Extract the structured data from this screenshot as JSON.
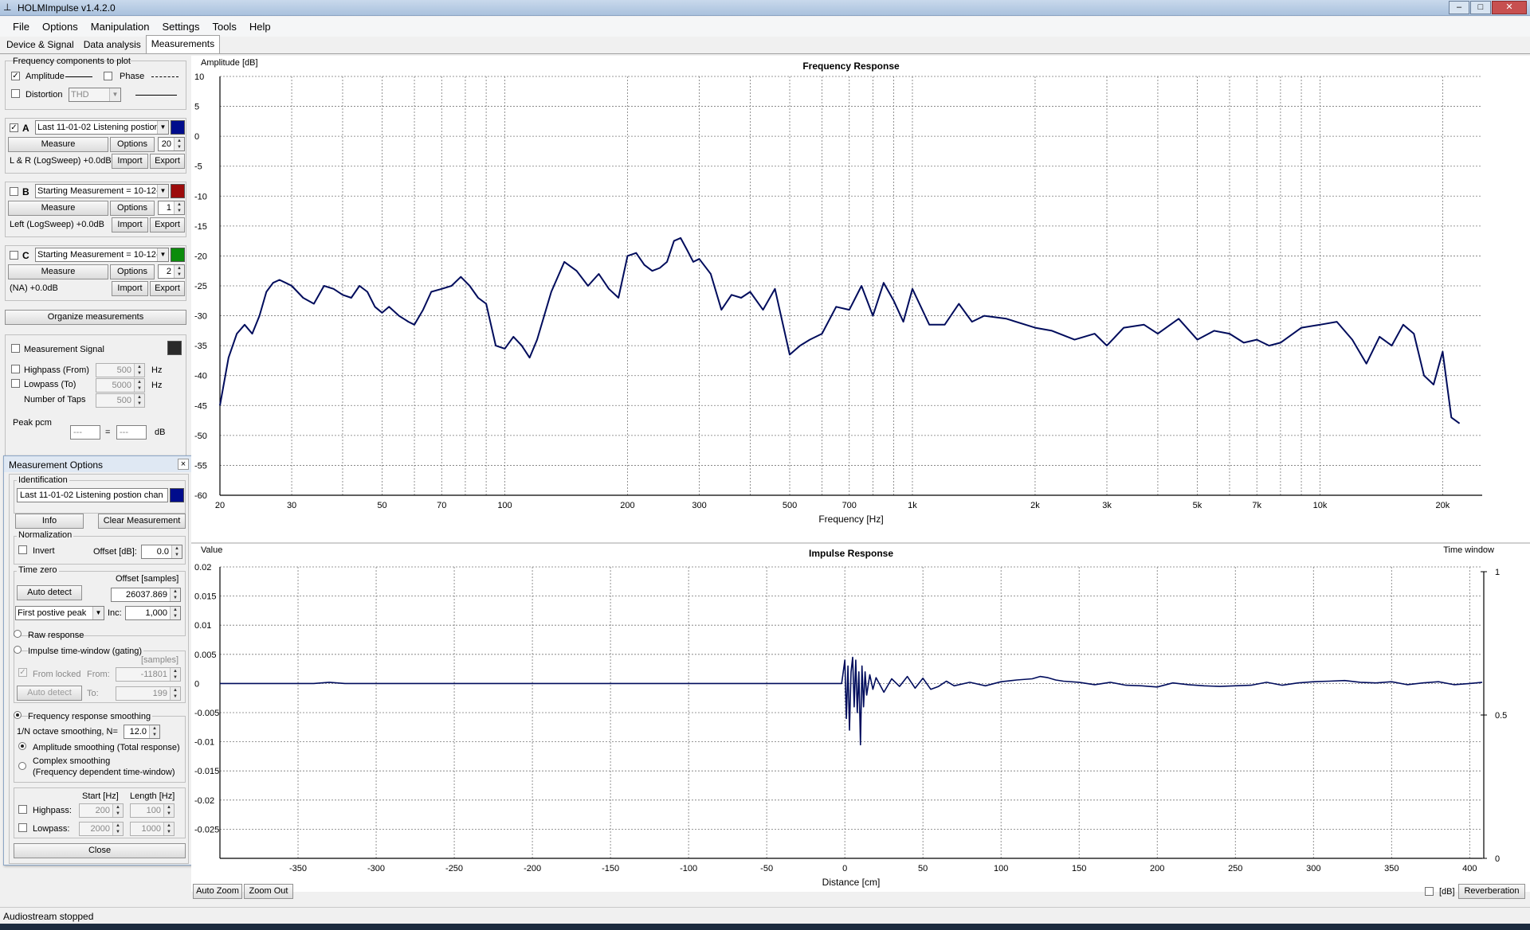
{
  "window": {
    "title": "HOLMImpulse  v1.4.2.0"
  },
  "menu": [
    "File",
    "Options",
    "Manipulation",
    "Settings",
    "Tools",
    "Help"
  ],
  "tabs": [
    "Device & Signal",
    "Data analysis",
    "Measurements"
  ],
  "freq_components": {
    "title": "Frequency components to plot",
    "amplitude_label": "Amplitude",
    "phase_label": "Phase",
    "distortion_label": "Distortion",
    "distortion_value": "THD"
  },
  "measurements": [
    {
      "letter": "A",
      "name": "Last 11-01-02 Listening postion",
      "measure": "Measure",
      "options": "Options",
      "count": "20",
      "info": "L & R (LogSweep) +0.0dB",
      "import": "Import",
      "export": "Export",
      "color": "#000c8c",
      "checked": true
    },
    {
      "letter": "B",
      "name": "Starting Measurement = 10-12-",
      "measure": "Measure",
      "options": "Options",
      "count": "1",
      "info": "Left (LogSweep) +0.0dB",
      "import": "Import",
      "export": "Export",
      "color": "#9c0c0c",
      "checked": false
    },
    {
      "letter": "C",
      "name": "Starting Measurement = 10-12-",
      "measure": "Measure",
      "options": "Options",
      "count": "2",
      "info": "(NA) +0.0dB",
      "import": "Import",
      "export": "Export",
      "color": "#0c8c0c",
      "checked": false
    }
  ],
  "organize_label": "Organize measurements",
  "signal": {
    "label": "Measurement Signal",
    "color": "#2a2a2a",
    "highpass_label": "Highpass (From)",
    "highpass_value": "500",
    "lowpass_label": "Lowpass (To)",
    "lowpass_value": "5000",
    "hz": "Hz",
    "taps_label": "Number of Taps",
    "taps_value": "500"
  },
  "peak": {
    "label": "Peak pcm",
    "left": "---",
    "eq": "=",
    "right": "---",
    "unit": "dB"
  },
  "options_panel": {
    "title": "Measurement Options",
    "close_x": "×",
    "identification_label": "Identification",
    "identification_value": "Last 11-01-02 Listening postion chan",
    "info_btn": "Info",
    "clear_btn": "Clear Measurement",
    "normalization_label": "Normalization",
    "invert_label": "Invert",
    "offset_db_label": "Offset [dB]:",
    "offset_db_value": "0.0",
    "timezero_label": "Time zero",
    "offset_samples_label": "Offset [samples]",
    "autodetect_btn": "Auto detect",
    "offset_samples_value": "26037.869",
    "peak_mode": "First postive peak",
    "inc_label": "Inc:",
    "inc_value": "1,000",
    "raw_label": "Raw response",
    "impulse_label": "Impulse time-window (gating)",
    "samples_label": "[samples]",
    "from_locked_label": "From locked",
    "from_label": "From:",
    "from_value": "-11801",
    "autodetect2_btn": "Auto detect",
    "to_label": "To:",
    "to_value": "199",
    "smoothing_label": "Frequency response smoothing",
    "octave_label": "1/N octave smoothing, N=",
    "octave_value": "12.0",
    "amp_smoothing_label": "Amplitude smoothing (Total response)",
    "complex_label_1": "Complex smoothing",
    "complex_label_2": "(Frequency dependent time-window)",
    "start_hz_label": "Start [Hz]",
    "length_hz_label": "Length [Hz]",
    "highpass_label": "Highpass:",
    "highpass_start": "200",
    "highpass_length": "100",
    "lowpass_label": "Lowpass:",
    "lowpass_start": "2000",
    "lowpass_length": "1000",
    "close_btn": "Close"
  },
  "bottom_controls": {
    "auto_zoom": "Auto Zoom",
    "zoom_out": "Zoom Out",
    "db_label": "[dB]",
    "reverberation": "Reverberation"
  },
  "status": "Audiostream stopped",
  "chart_data": [
    {
      "type": "line",
      "title": "Frequency Response",
      "xlabel": "Frequency [Hz]",
      "ylabel": "Amplitude [dB]",
      "xscale": "log",
      "xlim": [
        20,
        25000
      ],
      "ylim": [
        -60,
        10
      ],
      "grid": true,
      "x_ticks": [
        "20",
        "30",
        "50",
        "70",
        "100",
        "200",
        "300",
        "500",
        "700",
        "1k",
        "2k",
        "3k",
        "5k",
        "7k",
        "10k",
        "20k"
      ],
      "y_ticks": [
        "10",
        "5",
        "0",
        "-5",
        "-10",
        "-15",
        "-20",
        "-25",
        "-30",
        "-35",
        "-40",
        "-45",
        "-50",
        "-55",
        "-60"
      ],
      "series": [
        {
          "color": "#000c5c",
          "x": [
            20,
            21,
            22,
            23,
            24,
            25,
            26,
            27,
            28,
            29,
            30,
            32,
            34,
            36,
            38,
            40,
            42,
            44,
            46,
            48,
            50,
            52,
            55,
            58,
            60,
            63,
            66,
            70,
            74,
            78,
            82,
            86,
            90,
            95,
            100,
            105,
            110,
            115,
            120,
            130,
            140,
            150,
            160,
            170,
            180,
            190,
            200,
            210,
            220,
            230,
            240,
            250,
            260,
            270,
            280,
            290,
            300,
            320,
            340,
            360,
            380,
            400,
            430,
            460,
            500,
            530,
            560,
            600,
            650,
            700,
            750,
            800,
            850,
            900,
            950,
            1000,
            1100,
            1200,
            1300,
            1400,
            1500,
            1700,
            2000,
            2200,
            2500,
            2800,
            3000,
            3300,
            3700,
            4000,
            4500,
            5000,
            5500,
            6000,
            6500,
            7000,
            7500,
            8000,
            9000,
            10000,
            11000,
            12000,
            13000,
            14000,
            15000,
            16000,
            17000,
            18000,
            19000,
            20000,
            21000,
            22000
          ],
          "y": [
            -45,
            -37,
            -33,
            -31.5,
            -33,
            -30,
            -26,
            -24.5,
            -24,
            -24.5,
            -25,
            -27,
            -28,
            -25,
            -25.5,
            -26.5,
            -27,
            -25,
            -26,
            -28.5,
            -29.5,
            -28.5,
            -30,
            -31,
            -31.5,
            -29,
            -26,
            -25.5,
            -25,
            -23.5,
            -25,
            -27,
            -28,
            -35,
            -35.5,
            -33.5,
            -35,
            -37,
            -34,
            -26,
            -21,
            -22.5,
            -25,
            -23,
            -25.5,
            -27,
            -20,
            -19.5,
            -21.5,
            -22.5,
            -22,
            -21,
            -17.5,
            -17,
            -19,
            -21,
            -20.5,
            -23,
            -29,
            -26.5,
            -27,
            -26,
            -29,
            -25.5,
            -36.5,
            -35,
            -34,
            -33,
            -28.5,
            -29,
            -25,
            -30,
            -24.5,
            -27.5,
            -31,
            -25.5,
            -31.5,
            -31.5,
            -28,
            -31,
            -30,
            -30.5,
            -32,
            -32.5,
            -34,
            -33,
            -35,
            -32,
            -31.5,
            -33,
            -30.5,
            -34,
            -32.5,
            -33,
            -34.5,
            -34,
            -35,
            -34.5,
            -32,
            -31.5,
            -31,
            -34,
            -38,
            -33.5,
            -35,
            -31.5,
            -33,
            -40,
            -41.5,
            -36,
            -47,
            -48
          ]
        }
      ]
    },
    {
      "type": "line",
      "title": "Impulse Response",
      "xlabel": "Distance [cm]",
      "ylabel": "Value",
      "xlim": [
        -400,
        408
      ],
      "ylim": [
        -0.03,
        0.02
      ],
      "grid": true,
      "secondary_axis_label": "Time window",
      "secondary_axis_ticks": [
        "1",
        "0.5",
        "0"
      ],
      "x_ticks": [
        "-350",
        "-300",
        "-250",
        "-200",
        "-150",
        "-100",
        "-50",
        "0",
        "50",
        "100",
        "150",
        "200",
        "250",
        "300",
        "350",
        "400"
      ],
      "y_ticks": [
        "0.02",
        "0.015",
        "0.01",
        "0.005",
        "0",
        "-0.005",
        "-0.01",
        "-0.015",
        "-0.02",
        "-0.025"
      ],
      "series": [
        {
          "color": "#000c5c",
          "x": [
            -400,
            -340,
            -330,
            -320,
            -100,
            -2,
            0,
            1,
            2,
            3,
            4,
            5,
            6,
            7,
            8,
            9,
            10,
            11,
            12,
            13,
            14,
            16,
            18,
            20,
            25,
            30,
            35,
            40,
            45,
            50,
            55,
            60,
            65,
            70,
            80,
            90,
            100,
            110,
            120,
            125,
            130,
            135,
            140,
            150,
            160,
            170,
            180,
            190,
            200,
            210,
            220,
            230,
            240,
            250,
            260,
            270,
            280,
            290,
            300,
            310,
            320,
            330,
            340,
            350,
            360,
            370,
            380,
            390,
            400,
            408
          ],
          "y": [
            0,
            0,
            0.0002,
            0,
            0,
            0,
            0.004,
            -0.006,
            0.003,
            -0.008,
            0.002,
            0.0045,
            -0.004,
            0.004,
            -0.005,
            0.002,
            -0.0105,
            0.003,
            -0.004,
            0.002,
            -0.002,
            0.0015,
            -0.001,
            0.001,
            -0.0015,
            0.0008,
            -0.0005,
            0.0012,
            -0.0008,
            0.0009,
            -0.001,
            -0.0005,
            0.0004,
            -0.0004,
            0.0002,
            -0.0004,
            0.0003,
            0.0006,
            0.0008,
            0.0012,
            0.001,
            0.0006,
            0.0004,
            0.0002,
            -0.0002,
            0.0002,
            -0.0003,
            -0.0004,
            -0.0006,
            0.0001,
            -0.0002,
            -0.0004,
            -0.0005,
            -0.0004,
            -0.0003,
            0.0002,
            -0.0003,
            0.0001,
            0.0003,
            0.0004,
            0.0005,
            0.0002,
            0.0001,
            0.0003,
            -0.0002,
            0.0001,
            0.0003,
            -0.0002,
            0,
            0.0002
          ]
        }
      ]
    }
  ]
}
